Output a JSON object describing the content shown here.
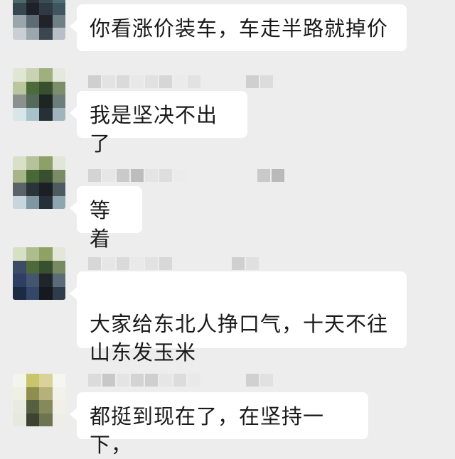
{
  "messages": [
    {
      "text": "你看涨价装车，车走半路就掉价"
    },
    {
      "text": "我是坚决不出了"
    },
    {
      "text": "等着"
    },
    {
      "text": "大家给东北人挣口气，十天不往\n山东发玉米"
    },
    {
      "text": "都挺到现在了，在坚持一下，"
    }
  ]
}
